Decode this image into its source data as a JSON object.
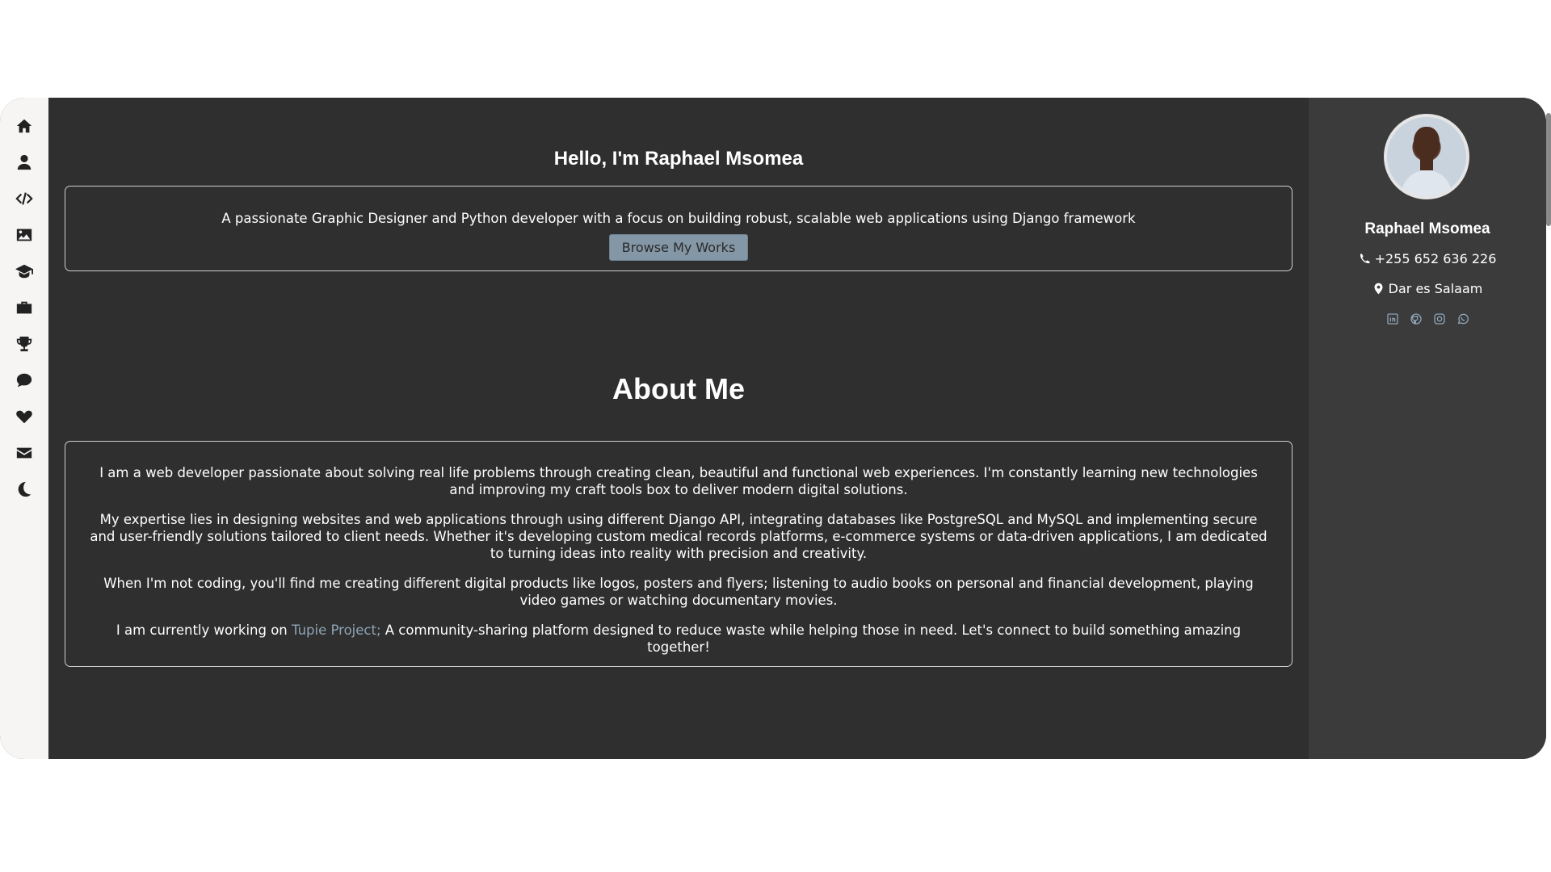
{
  "nav": {
    "items": [
      {
        "name": "home-icon"
      },
      {
        "name": "user-icon"
      },
      {
        "name": "code-icon"
      },
      {
        "name": "image-icon"
      },
      {
        "name": "graduation-cap-icon"
      },
      {
        "name": "briefcase-icon"
      },
      {
        "name": "trophy-icon"
      },
      {
        "name": "comment-icon"
      },
      {
        "name": "heart-icon"
      },
      {
        "name": "envelope-icon"
      },
      {
        "name": "moon-icon"
      }
    ]
  },
  "hero": {
    "title": "Hello, I'm Raphael Msomea",
    "description": "A passionate Graphic Designer and Python developer with a focus on building robust, scalable web applications using Django framework",
    "button_label": "Browse My Works"
  },
  "about": {
    "title": "About Me",
    "p1": "I am a web developer passionate about solving real life problems through creating clean, beautiful and functional web experiences. I'm constantly learning new technologies and improving my craft tools box to deliver modern digital solutions.",
    "p2": "My expertise lies in designing websites and web applications through using different Django API, integrating databases like PostgreSQL and MySQL and implementing secure and user-friendly solutions tailored to client needs. Whether it's developing custom medical records platforms, e-commerce systems or data-driven applications, I am dedicated to turning ideas into reality with precision and creativity.",
    "p3": "When I'm not coding, you'll find me creating different digital products like logos, posters and flyers; listening to audio books on personal and financial development, playing video games or watching documentary movies.",
    "p4_prefix": "I am currently working on ",
    "p4_link": "Tupie Project;",
    "p4_suffix": " A community-sharing platform designed to reduce waste while helping those in need. Let's connect to build something amazing together!"
  },
  "profile": {
    "name": "Raphael Msomea",
    "phone": "+255 652 636 226",
    "location": "Dar es Salaam",
    "socials": [
      "linkedin-icon",
      "github-icon",
      "instagram-icon",
      "whatsapp-icon"
    ]
  },
  "colors": {
    "main_bg": "#2f2f2f",
    "profile_bg": "#3b3b3b",
    "nav_bg": "#f6f5f4",
    "accent": "#8ea4b6",
    "button_bg": "#8497a6"
  }
}
